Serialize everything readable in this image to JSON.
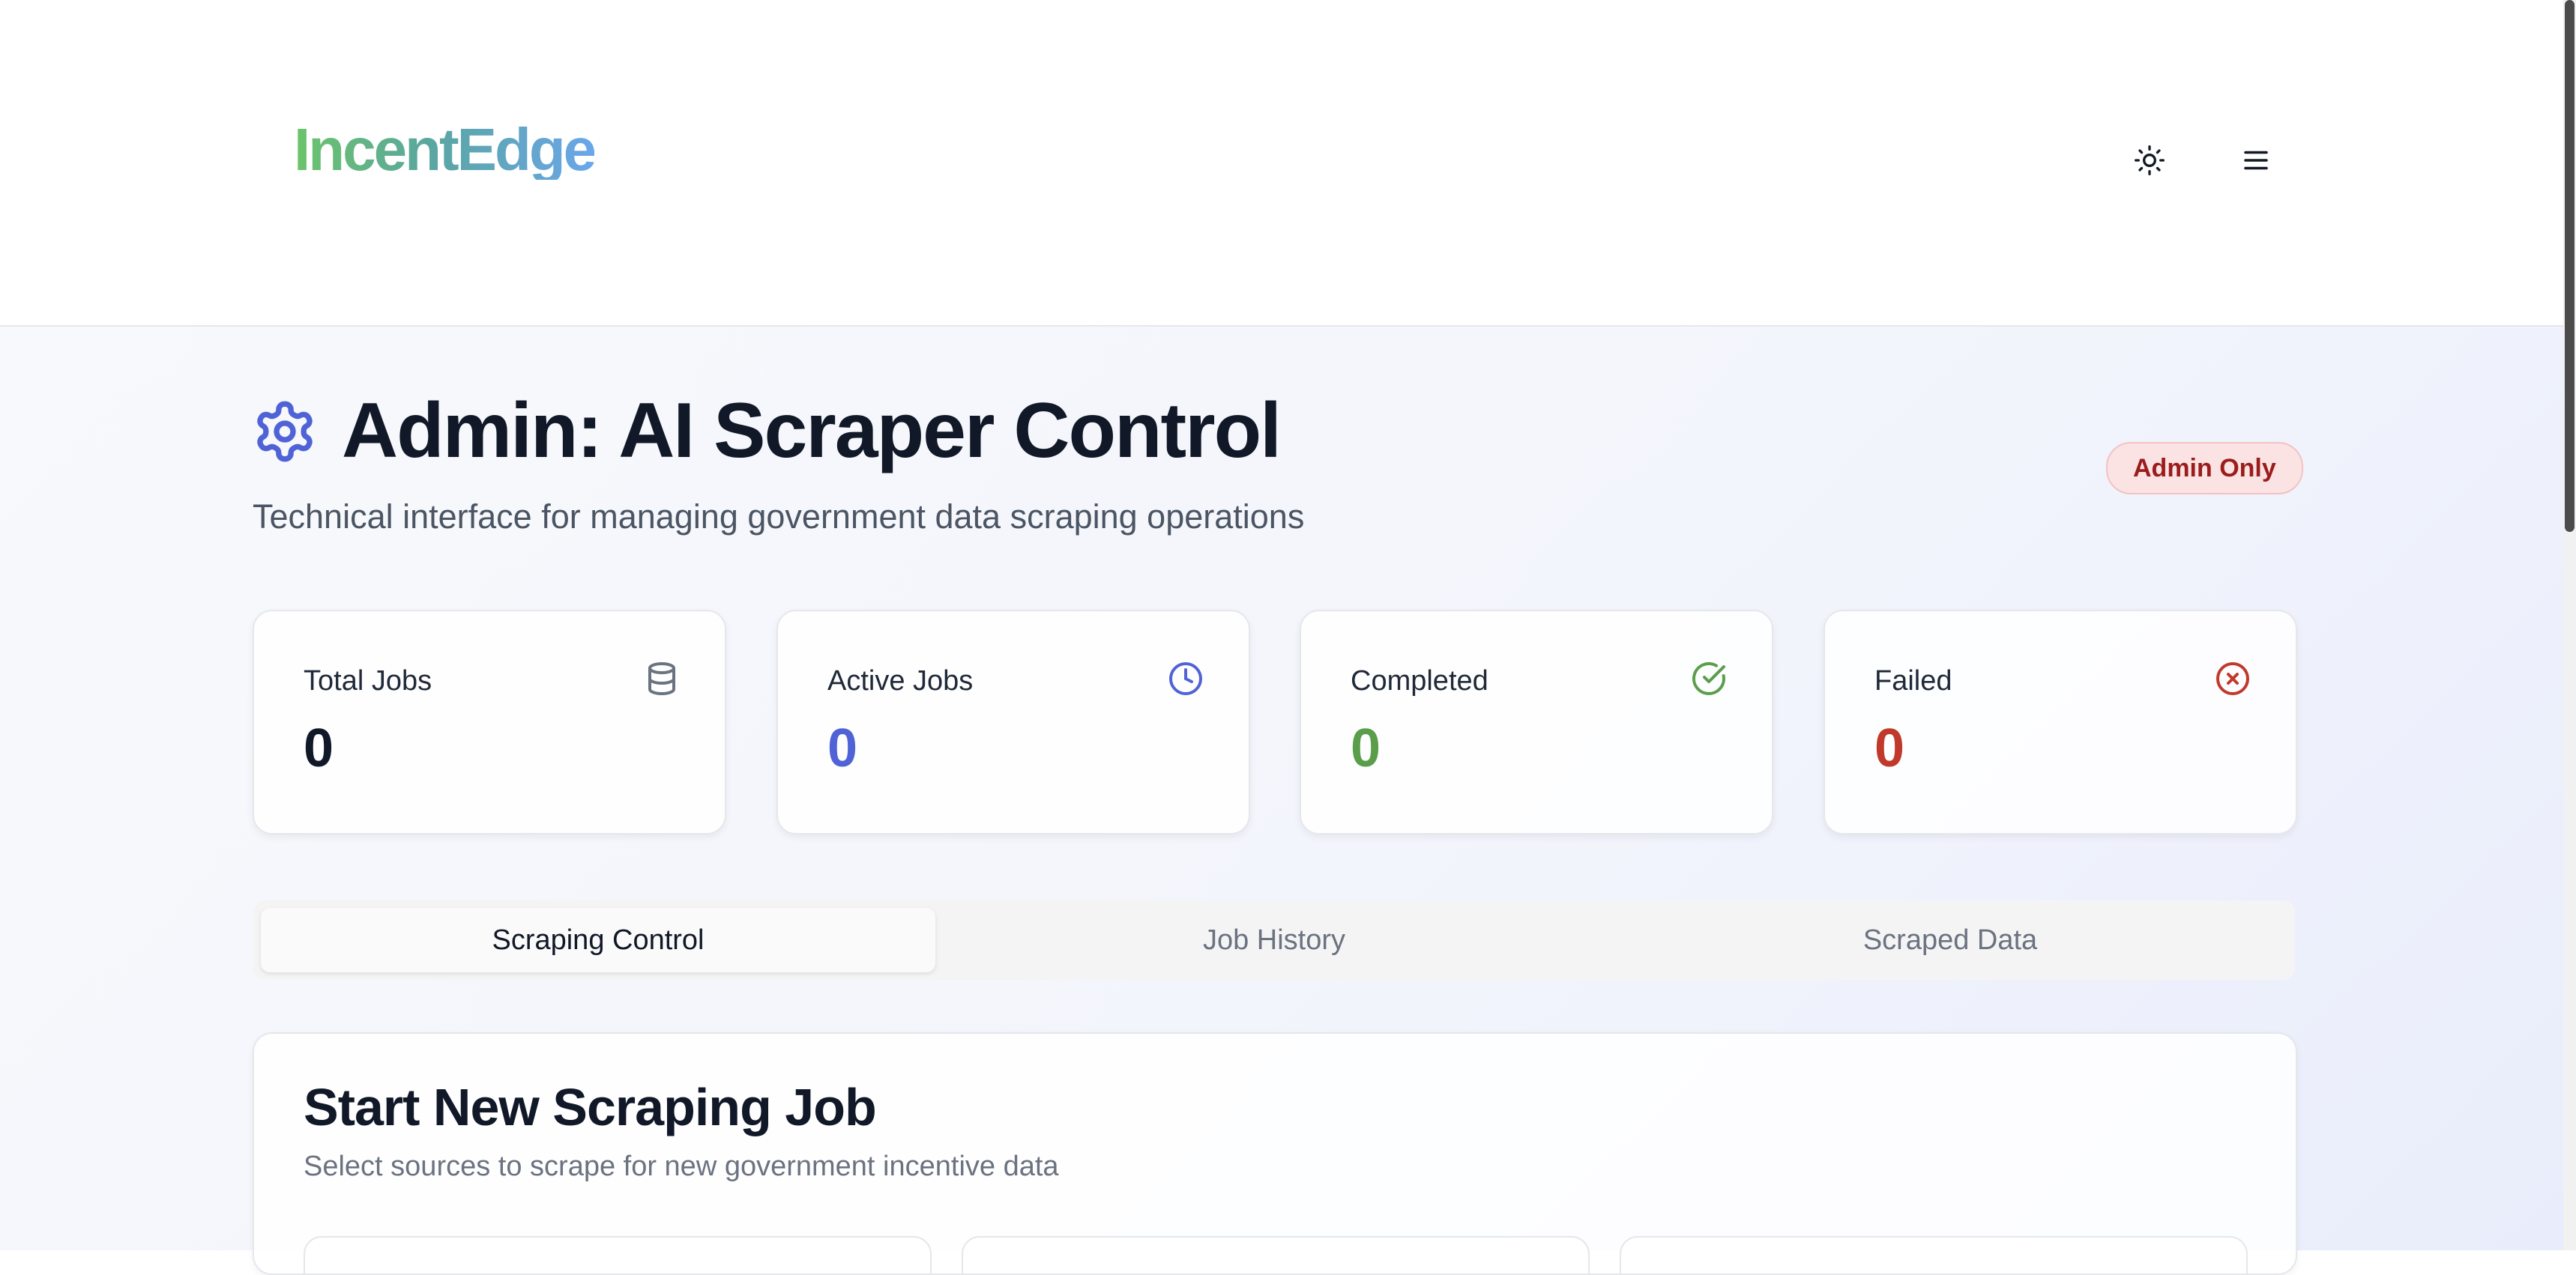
{
  "header": {
    "logo": "IncentEdge",
    "theme_toggle_icon": "sun-icon",
    "menu_icon": "hamburger-menu-icon"
  },
  "page": {
    "title": "Admin: AI Scraper Control",
    "title_icon": "gear-icon",
    "subtitle": "Technical interface for managing government data scraping operations",
    "badge": "Admin Only"
  },
  "stats": [
    {
      "label": "Total Jobs",
      "value": "0",
      "icon": "database-icon",
      "color": "#111827"
    },
    {
      "label": "Active Jobs",
      "value": "0",
      "icon": "clock-icon",
      "color": "#4f63d6"
    },
    {
      "label": "Completed",
      "value": "0",
      "icon": "check-circle-icon",
      "color": "#5a9e4b"
    },
    {
      "label": "Failed",
      "value": "0",
      "icon": "x-circle-icon",
      "color": "#c0392b"
    }
  ],
  "tabs": [
    {
      "label": "Scraping Control",
      "active": true
    },
    {
      "label": "Job History",
      "active": false
    },
    {
      "label": "Scraped Data",
      "active": false
    }
  ],
  "panel": {
    "title": "Start New Scraping Job",
    "description": "Select sources to scrape for new government incentive data"
  },
  "colors": {
    "accent": "#4f63d6",
    "success": "#5a9e4b",
    "danger": "#c0392b",
    "badge_bg": "#fbe3e3",
    "badge_text": "#9b1c1c"
  }
}
